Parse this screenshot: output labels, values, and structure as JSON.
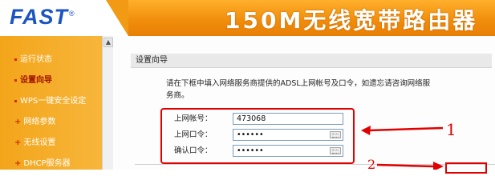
{
  "header": {
    "brand": "FAST",
    "registered_mark": "®",
    "banner_title": "150M无线宽带路由器"
  },
  "sidebar": {
    "items": [
      {
        "label": "运行状态",
        "marker": "bullet"
      },
      {
        "label": "设置向导",
        "marker": "bullet",
        "active": true
      },
      {
        "label": "WPS一键安全设定",
        "marker": "bullet"
      },
      {
        "label": "网络参数",
        "marker": "plus"
      },
      {
        "label": "无线设置",
        "marker": "plus"
      },
      {
        "label": "DHCP服务器",
        "marker": "plus"
      }
    ]
  },
  "panel": {
    "title": "设置向导",
    "description": "请在下框中填入网络服务商提供的ADSL上网帐号及口令，如遗忘请咨询网络服务商。",
    "fields": [
      {
        "label": "上网帐号：",
        "value": "473068",
        "masked": false
      },
      {
        "label": "上网口令：",
        "value": "••••••",
        "masked": true
      },
      {
        "label": "确认口令：",
        "value": "••••••",
        "masked": true
      }
    ]
  },
  "annotations": {
    "step1": "1",
    "step2": "2",
    "color": "#e00000"
  },
  "colors": {
    "brand_blue": "#1a55c2",
    "banner_orange": "#f29a14",
    "sidebar_orange": "#f5ad2b"
  }
}
